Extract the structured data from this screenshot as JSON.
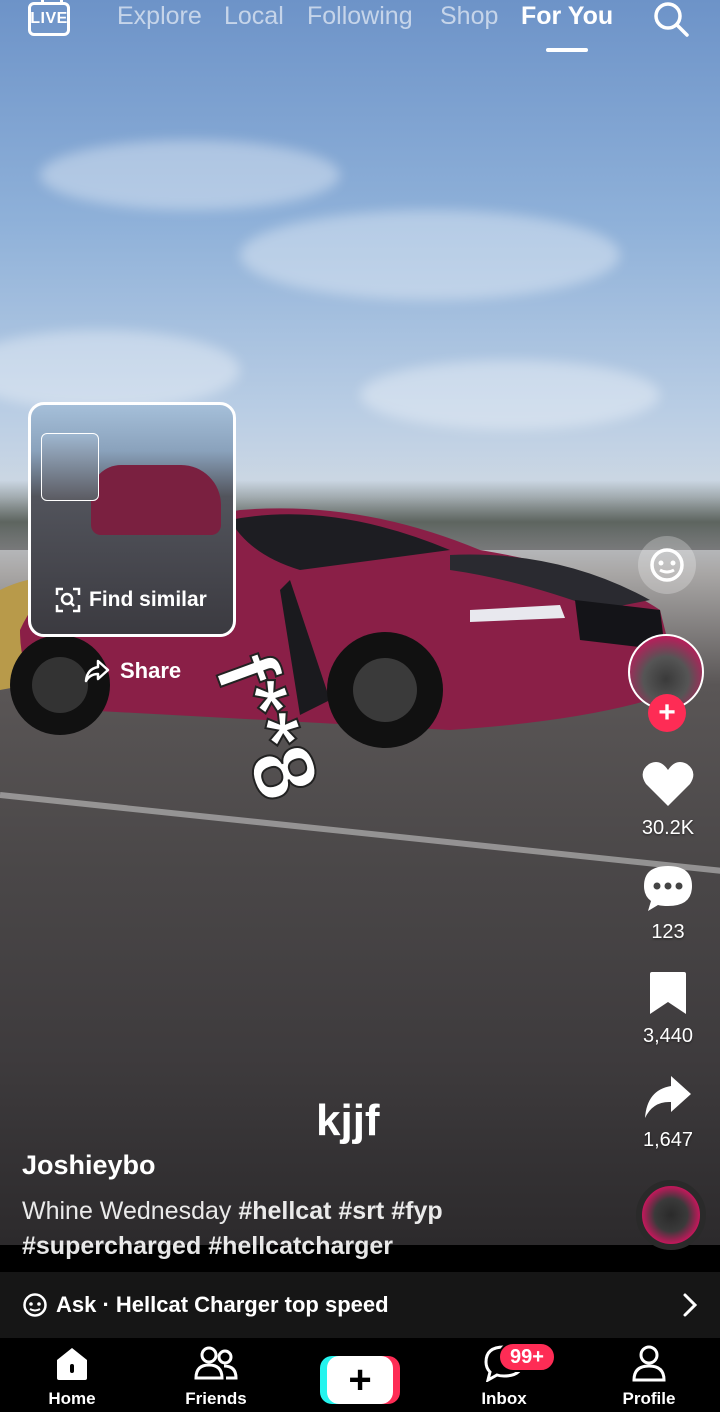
{
  "topnav": {
    "live_label": "LIVE",
    "tabs": [
      {
        "label": "Explore"
      },
      {
        "label": "Local"
      },
      {
        "label": "Following"
      },
      {
        "label": "Shop"
      },
      {
        "label": "For You"
      }
    ],
    "active_tab": "For You"
  },
  "popup": {
    "find_similar_label": "Find similar",
    "share_label": "Share"
  },
  "video": {
    "overlay_text": "f**8",
    "caption_title": "kjjf"
  },
  "rail": {
    "likes": "30.2K",
    "comments": "123",
    "saves": "3,440",
    "shares": "1,647"
  },
  "post": {
    "username": "Joshieybo",
    "description_text": "Whine Wednesday",
    "hashtags": [
      "#hellcat",
      "#srt",
      "#fyp",
      "#supercharged",
      "#hellcatcharger"
    ]
  },
  "askbar": {
    "label": "Ask · Hellcat Charger top speed"
  },
  "bottomnav": {
    "items": [
      {
        "label": "Home",
        "icon": "home-icon"
      },
      {
        "label": "Friends",
        "icon": "friends-icon"
      },
      {
        "label": "",
        "icon": "create-icon"
      },
      {
        "label": "Inbox",
        "icon": "inbox-icon"
      },
      {
        "label": "Profile",
        "icon": "profile-icon"
      }
    ],
    "inbox_badge": "99+"
  },
  "colors": {
    "accent_red": "#fe2c55",
    "accent_cyan": "#25f4ee",
    "car_body": "#8a1f47"
  }
}
